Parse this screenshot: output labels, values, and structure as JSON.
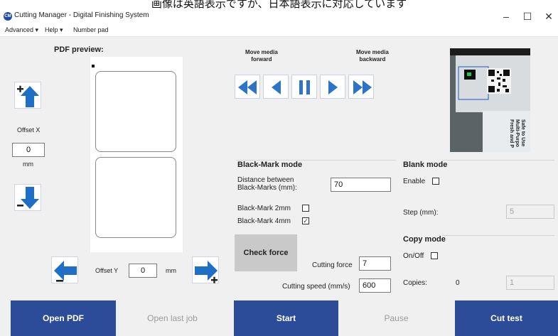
{
  "caption": "画像は英語表示ですが、日本語表示に対応しています",
  "window": {
    "title": "Cutting Manager - Digital Finishing System",
    "app_icon_text": "CM",
    "minimize": "–",
    "maximize": "☐",
    "close": "✕"
  },
  "menu": [
    "Advanced ▾",
    "Help ▾",
    "Number pad"
  ],
  "preview": {
    "label": "PDF preview:"
  },
  "offset_x": {
    "label": "Offset X",
    "value": "0",
    "unit": "mm"
  },
  "offset_y": {
    "label": "Offset Y",
    "value": "0",
    "unit": "mm"
  },
  "media": {
    "forward_label": "Move media\nforward",
    "backward_label": "Move media\nbackward"
  },
  "camera": {
    "sticker_text": "Safe to Use\nMulti-Purpo\nFresh and P"
  },
  "black_mark": {
    "title": "Black-Mark mode",
    "distance_label": "Distance between\nBlack-Marks (mm):",
    "distance_value": "70",
    "mark_2mm_label": "Black-Mark 2mm",
    "mark_2mm_checked": false,
    "mark_4mm_label": "Black-Mark 4mm",
    "mark_4mm_checked": true
  },
  "blank_mode": {
    "title": "Blank mode",
    "enable_label": "Enable",
    "enable_checked": false,
    "step_label": "Step (mm):",
    "step_value": "5"
  },
  "copy_mode": {
    "title": "Copy mode",
    "onoff_label": "On/Off",
    "onoff_checked": false,
    "copies_label": "Copies:",
    "copies_count": "0",
    "copies_value": "1"
  },
  "force": {
    "check_button": "Check force",
    "cutting_force_label": "Cutting force",
    "cutting_force_value": "7",
    "cutting_speed_label": "Cutting speed (mm/s)",
    "cutting_speed_value": "600"
  },
  "bottom": {
    "open_pdf": "Open PDF",
    "open_last_job": "Open last job",
    "start": "Start",
    "pause": "Pause",
    "cut_test": "Cut test"
  },
  "colors": {
    "accent": "#2c4b98",
    "arrow": "#1f6fc6",
    "media_icon": "#2d73c8"
  },
  "icons": {
    "up": "arrow-up-plus-icon",
    "down": "arrow-down-minus-icon",
    "left": "arrow-left-minus-icon",
    "right": "arrow-right-plus-icon",
    "fast_back": "fast-rewind-icon",
    "back": "step-back-icon",
    "pause": "pause-icon",
    "forward": "step-forward-icon",
    "fast_forward": "fast-forward-icon"
  }
}
